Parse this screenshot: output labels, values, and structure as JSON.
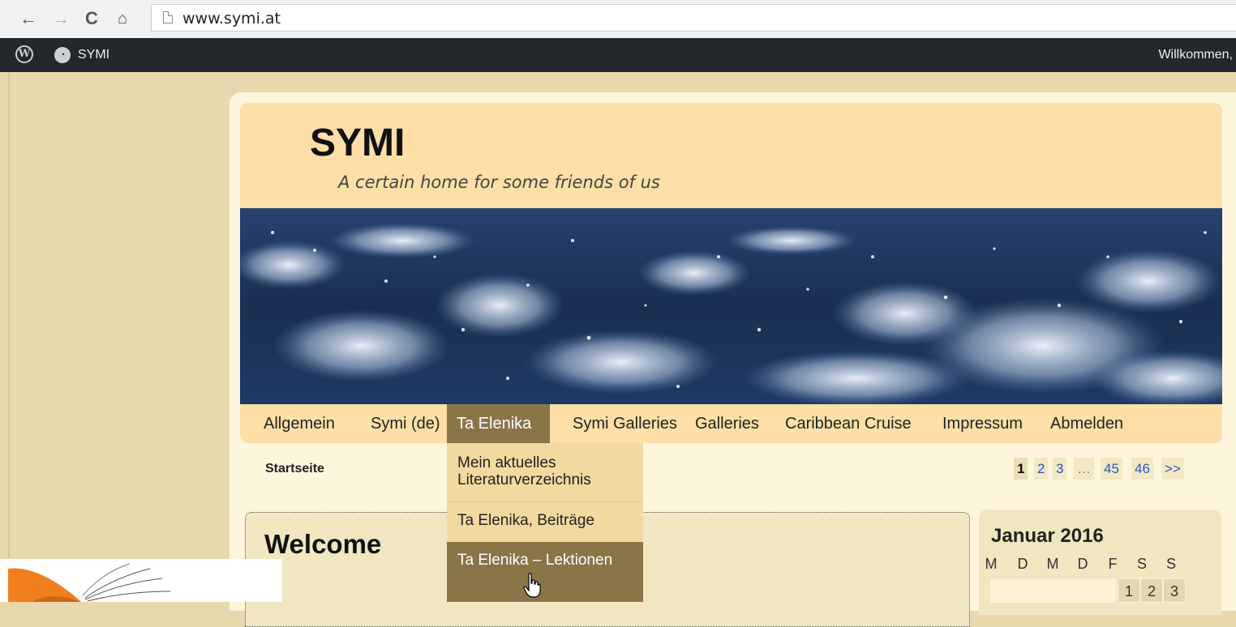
{
  "browser": {
    "url": "www.symi.at"
  },
  "adminbar": {
    "site_name": "SYMI",
    "welcome": "Willkommen,"
  },
  "header": {
    "title": "SYMI",
    "tagline": "A certain home for some friends of us"
  },
  "menu": {
    "items": [
      "Allgemein",
      "Symi (de)",
      "Ta Elenika",
      "Symi Galleries",
      "Galleries",
      "Caribbean Cruise",
      "Impressum",
      "Abmelden"
    ],
    "active": "Ta Elenika"
  },
  "dropdown": {
    "items": [
      "Mein aktuelles Literaturverzeichnis",
      "Ta Elenika, Beiträge",
      "Ta Elenika – Lektionen"
    ]
  },
  "breadcrumb": "Startseite",
  "pagination": {
    "items": [
      "1",
      "2",
      "3",
      "…",
      "45",
      "46",
      ">>"
    ],
    "current": "1"
  },
  "post": {
    "title": "Welcome"
  },
  "calendar": {
    "title": "Januar 2016",
    "weekdays": [
      "M",
      "D",
      "M",
      "D",
      "F",
      "S",
      "S"
    ],
    "first_row": [
      "1",
      "2",
      "3"
    ]
  },
  "colors": {
    "menu_active": "#8a7549",
    "header_bg": "#fddfa7",
    "adminbar_bg": "#23282d"
  }
}
